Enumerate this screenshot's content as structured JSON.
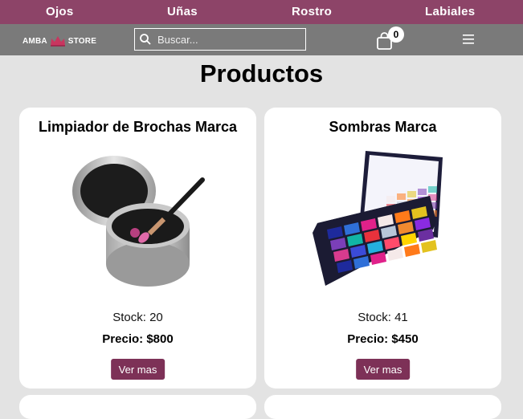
{
  "nav": [
    "Ojos",
    "Uñas",
    "Rostro",
    "Labiales"
  ],
  "logo": {
    "left": "AMBA",
    "right": "STORE"
  },
  "search": {
    "placeholder": "Buscar..."
  },
  "cart": {
    "count": "0"
  },
  "page_title": "Productos",
  "products": [
    {
      "name": "Limpiador de Brochas Marca",
      "stock": "Stock: 20",
      "price": "Precio: $800",
      "button": "Ver mas"
    },
    {
      "name": "Sombras Marca",
      "stock": "Stock: 41",
      "price": "Precio: $450",
      "button": "Ver mas"
    }
  ],
  "colors": {
    "nav_bg": "#8d4468",
    "toolbar_bg": "#7a7a7a",
    "button_bg": "#7d3157",
    "page_bg": "#e3e3e3"
  }
}
